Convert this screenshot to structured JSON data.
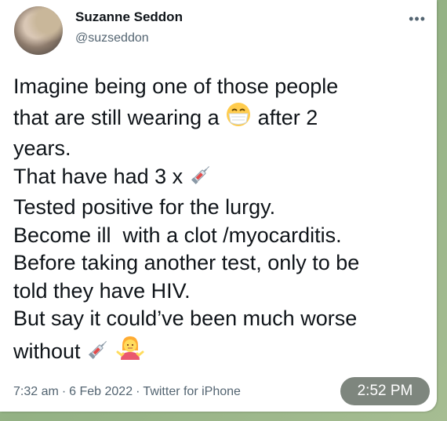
{
  "author": {
    "name": "Suzanne Seddon",
    "handle": "@suzseddon"
  },
  "more_icon": "more-dots-icon",
  "tweet": {
    "line1": "Imagine being one of those people",
    "line2_a": "that are still wearing a",
    "line2_emoji": "face-with-medical-mask-icon",
    "line2_b": "after 2",
    "line3": "years.",
    "line4_a": "That have had 3 x",
    "line4_emoji": "syringe-icon",
    "line5": "Tested positive for the lurgy.",
    "line6": "Become ill  with a clot /myocarditis.",
    "line7": "Before taking another test, only to be",
    "line8": "told they have HIV.",
    "line9": "But say it could’ve been much worse",
    "line10_a": "without",
    "line10_emoji1": "syringe-icon",
    "line10_emoji2": "woman-shrugging-icon"
  },
  "meta": {
    "time": "7:32 am",
    "date": "6 Feb 2022",
    "source": "Twitter for iPhone",
    "separator": "·"
  },
  "message_time": "2:52 PM",
  "colors": {
    "background": "#9fb88e",
    "card": "#ffffff",
    "text": "#0f1419",
    "muted": "#536471"
  }
}
